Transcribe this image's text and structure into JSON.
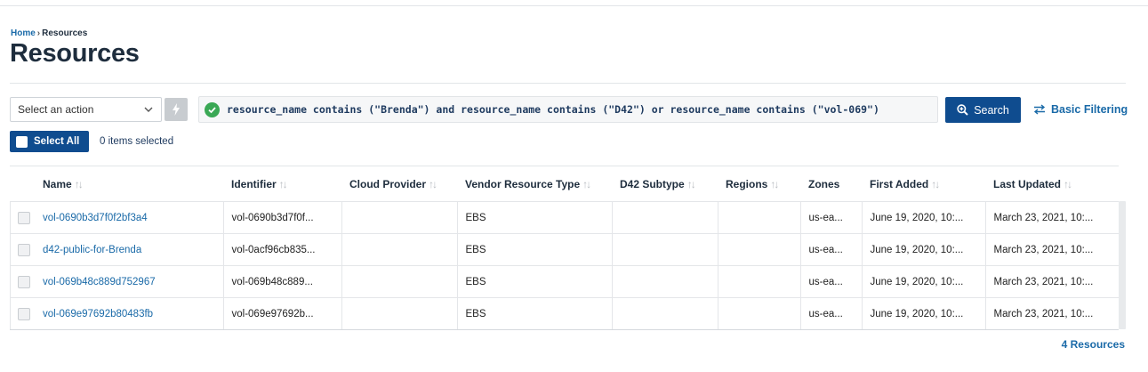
{
  "breadcrumb": {
    "home": "Home",
    "separator": "›",
    "current": "Resources"
  },
  "page_title": "Resources",
  "toolbar": {
    "action_select_value": "Select an action",
    "filter_query": "resource_name contains (\"Brenda\") and resource_name contains (\"D42\") or resource_name contains (\"vol-069\")",
    "search_label": "Search",
    "basic_filtering_label": "Basic Filtering",
    "select_all_label": "Select All",
    "items_selected": "0 items selected"
  },
  "table": {
    "columns": [
      {
        "label": "Name",
        "sortable": true
      },
      {
        "label": "Identifier",
        "sortable": true
      },
      {
        "label": "Cloud Provider",
        "sortable": true
      },
      {
        "label": "Vendor Resource Type",
        "sortable": true
      },
      {
        "label": "D42 Subtype",
        "sortable": true
      },
      {
        "label": "Regions",
        "sortable": true
      },
      {
        "label": "Zones",
        "sortable": false
      },
      {
        "label": "First Added",
        "sortable": true
      },
      {
        "label": "Last Updated",
        "sortable": true
      }
    ],
    "rows": [
      {
        "name": "vol-0690b3d7f0f2bf3a4",
        "identifier": "vol-0690b3d7f0f...",
        "cloud_provider": "",
        "vendor_type": "EBS",
        "d42_subtype": "",
        "regions": "",
        "zones": "us-ea...",
        "first_added": "June 19, 2020, 10:...",
        "last_updated": "March 23, 2021, 10:..."
      },
      {
        "name": "d42-public-for-Brenda",
        "identifier": "vol-0acf96cb835...",
        "cloud_provider": "",
        "vendor_type": "EBS",
        "d42_subtype": "",
        "regions": "",
        "zones": "us-ea...",
        "first_added": "June 19, 2020, 10:...",
        "last_updated": "March 23, 2021, 10:..."
      },
      {
        "name": "vol-069b48c889d752967",
        "identifier": "vol-069b48c889...",
        "cloud_provider": "",
        "vendor_type": "EBS",
        "d42_subtype": "",
        "regions": "",
        "zones": "us-ea...",
        "first_added": "June 19, 2020, 10:...",
        "last_updated": "March 23, 2021, 10:..."
      },
      {
        "name": "vol-069e97692b80483fb",
        "identifier": "vol-069e97692b...",
        "cloud_provider": "",
        "vendor_type": "EBS",
        "d42_subtype": "",
        "regions": "",
        "zones": "us-ea...",
        "first_added": "June 19, 2020, 10:...",
        "last_updated": "March 23, 2021, 10:..."
      }
    ]
  },
  "footer": {
    "count": "4 Resources"
  },
  "icons": {
    "filter_status": "check-circle-icon",
    "search": "zoom-in-icon",
    "basic_filtering": "swap-arrows-icon",
    "action_go": "lightning-icon",
    "sort": "sort-arrows-icon"
  },
  "colors": {
    "primary": "#0f4c8f",
    "link": "#1a6aa8",
    "valid": "#3aa855"
  }
}
